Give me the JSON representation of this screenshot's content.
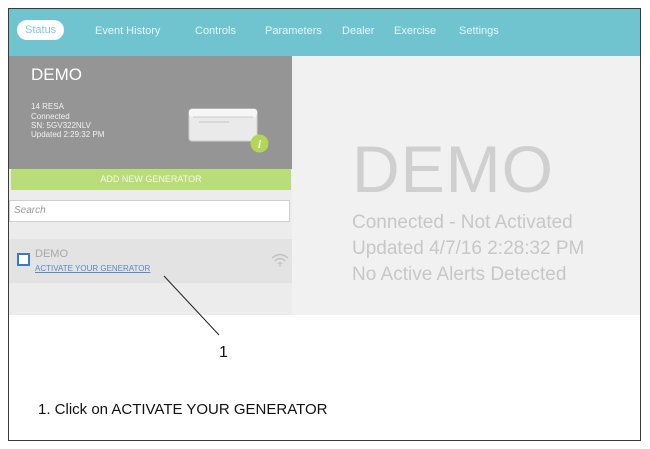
{
  "nav": {
    "tabs": [
      {
        "label": "Status",
        "active": true
      },
      {
        "label": "Event History"
      },
      {
        "label": "Controls"
      },
      {
        "label": "Parameters"
      },
      {
        "label": "Dealer"
      },
      {
        "label": "Exercise"
      },
      {
        "label": "Settings"
      }
    ]
  },
  "sidebar": {
    "device_card": {
      "name": "DEMO",
      "model": "14 RESA",
      "connection": "Connected",
      "serial": "SN: 5GV322NLV",
      "updated": "Updated 2:29:32 PM",
      "info_icon": "info-icon"
    },
    "add_button": "ADD NEW GENERATOR",
    "search_placeholder": "Search",
    "list": [
      {
        "name": "DEMO",
        "link": "ACTIVATE YOUR GENERATOR",
        "signal_icon": "wifi-icon"
      }
    ]
  },
  "main": {
    "title": "DEMO",
    "status": "Connected - Not Activated",
    "updated": "Updated 4/7/16 2:28:32 PM",
    "alerts": "No Active Alerts Detected"
  },
  "annotation": {
    "callout": "1",
    "instruction": "1.  Click on ACTIVATE YOUR GENERATOR"
  },
  "colors": {
    "nav_bg": "#6fc4d0",
    "sidebar_card": "#959595",
    "add_button": "#b9dd78",
    "info_badge": "#b3d657",
    "link": "#5a89c6"
  }
}
